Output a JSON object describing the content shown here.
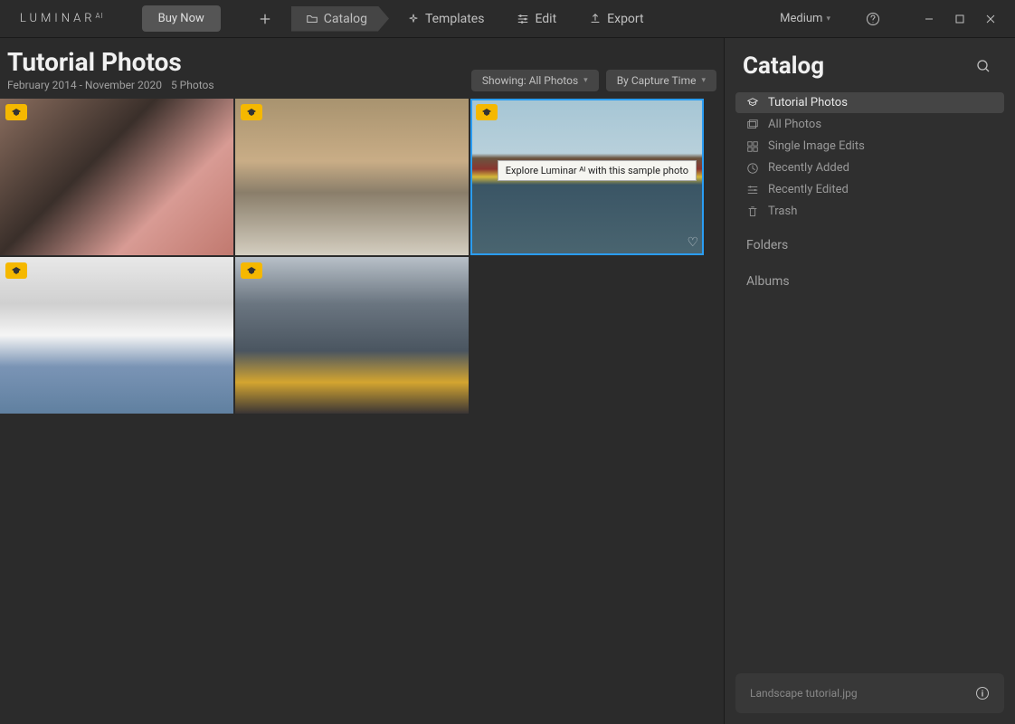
{
  "app": {
    "logo_text": "LUMINAR",
    "logo_sup": "AI"
  },
  "header": {
    "buy_now": "Buy Now",
    "nav": {
      "catalog": "Catalog",
      "templates": "Templates",
      "edit": "Edit",
      "export": "Export"
    },
    "size_label": "Medium"
  },
  "content": {
    "title": "Tutorial Photos",
    "date_range": "February 2014 - November 2020",
    "count": "5 Photos",
    "filter_showing": "Showing: All Photos",
    "filter_sort": "By Capture Time",
    "tooltip": "Explore Luminar ᴬᴵ with this sample photo"
  },
  "sidebar": {
    "title": "Catalog",
    "items": [
      {
        "label": "Tutorial Photos",
        "active": true
      },
      {
        "label": "All Photos",
        "active": false
      },
      {
        "label": "Single Image Edits",
        "active": false
      },
      {
        "label": "Recently Added",
        "active": false
      },
      {
        "label": "Recently Edited",
        "active": false
      },
      {
        "label": "Trash",
        "active": false
      }
    ],
    "folders_label": "Folders",
    "albums_label": "Albums",
    "footer_file": "Landscape tutorial.jpg"
  }
}
